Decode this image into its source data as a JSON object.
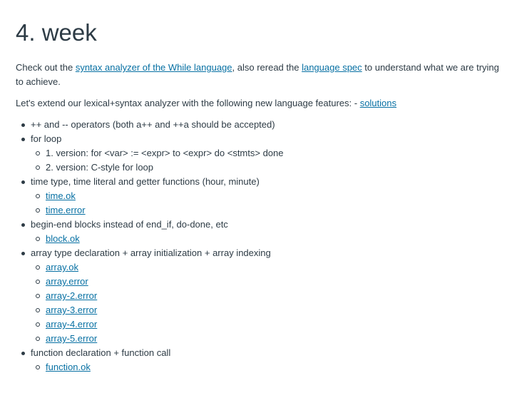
{
  "title": "4. week",
  "intro": {
    "t1": "Check out the ",
    "link1": "syntax analyzer of the While language",
    "t2": ", also reread the ",
    "link2": "language spec",
    "t3": " to understand what we are trying to achieve."
  },
  "extend": {
    "text": "Let's extend our lexical+syntax analyzer with the following new language features: - ",
    "link": "solutions"
  },
  "features": [
    {
      "label": "++ and -- operators (both a++ and ++a should be accepted)"
    },
    {
      "label": "for loop",
      "sub": [
        "1. version: for <var> := <expr> to <expr> do <stmts> done",
        "2. version: C-style for loop"
      ]
    },
    {
      "label": "time type, time literal and getter functions (hour, minute)",
      "links": [
        "time.ok",
        "time.error"
      ]
    },
    {
      "label": "begin-end blocks instead of end_if, do-done, etc",
      "links": [
        "block.ok"
      ]
    },
    {
      "label": "array type declaration + array initialization + array indexing",
      "links": [
        "array.ok",
        "array.error",
        "array-2.error",
        "array-3.error",
        "array-4.error",
        "array-5.error"
      ]
    },
    {
      "label": "function declaration + function call",
      "links": [
        "function.ok"
      ]
    }
  ]
}
